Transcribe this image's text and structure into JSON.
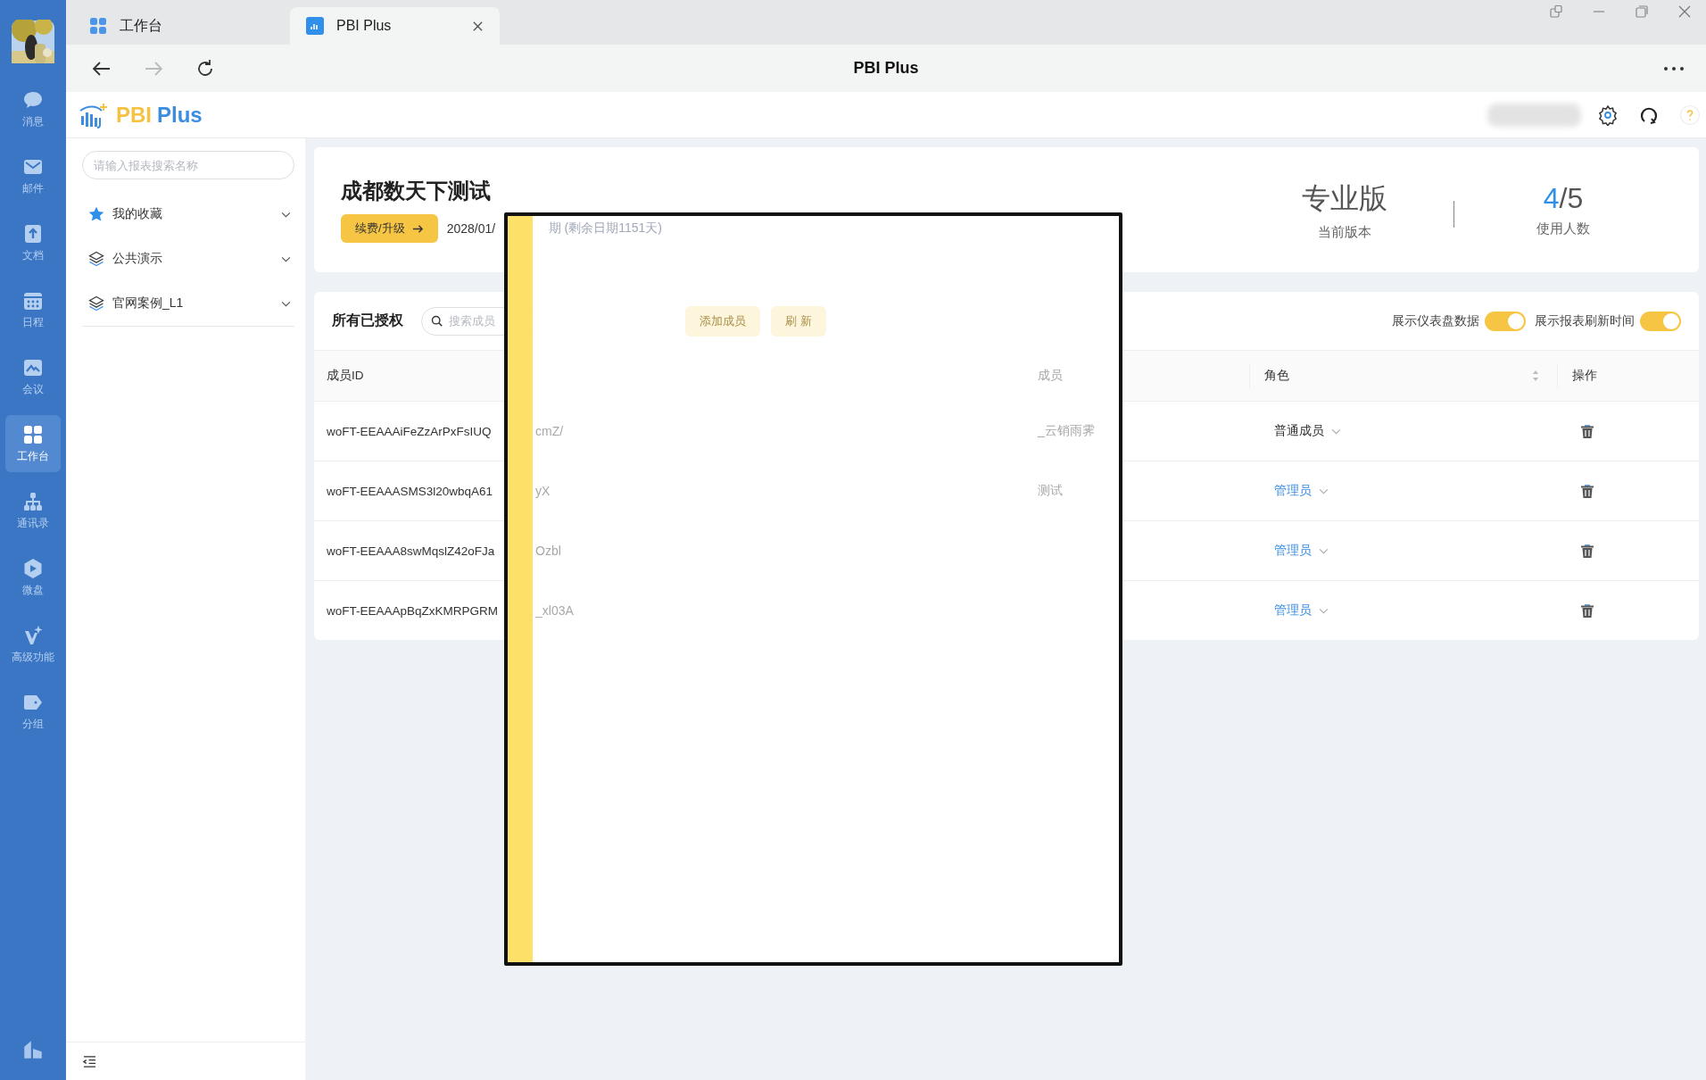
{
  "rail": {
    "items": [
      {
        "label": "消息",
        "selected": false
      },
      {
        "label": "邮件",
        "selected": false
      },
      {
        "label": "文档",
        "selected": false
      },
      {
        "label": "日程",
        "selected": false
      },
      {
        "label": "会议",
        "selected": false
      },
      {
        "label": "工作台",
        "selected": true
      },
      {
        "label": "通讯录",
        "selected": false
      },
      {
        "label": "微盘",
        "selected": false
      },
      {
        "label": "高级功能",
        "selected": false
      },
      {
        "label": "分组",
        "selected": false
      }
    ]
  },
  "tabs": [
    {
      "label": "工作台",
      "selected": false,
      "kind": "workspace"
    },
    {
      "label": "PBI Plus",
      "selected": true,
      "kind": "app"
    }
  ],
  "toolbar": {
    "title": "PBI Plus",
    "back_disabled": false,
    "forward_disabled": true
  },
  "app_header": {
    "logo_a": "PBI",
    "logo_b": "Plus"
  },
  "sidebar": {
    "search": {
      "placeholder": "请输入报表搜索名称"
    },
    "items": [
      {
        "label": "我的收藏",
        "kind": "star"
      },
      {
        "label": "公共演示",
        "kind": "layers"
      },
      {
        "label": "官网案例_L1",
        "kind": "layers"
      }
    ]
  },
  "org": {
    "name": "成都数天下测试",
    "renew_button": "续费/升级",
    "date": "2028/01/",
    "date_rest": "期 (剩余日期1151天)",
    "stats": [
      {
        "value": "专业版",
        "label": "当前版本"
      },
      {
        "value": "4",
        "value_total": "/5",
        "label": "使用人数"
      }
    ]
  },
  "members": {
    "title": "所有已授权",
    "search": {
      "placeholder": "搜索成员"
    },
    "add_button": "添加成员",
    "refresh_button": "刷 新",
    "toggles": [
      {
        "label": "展示仪表盘数据",
        "on": true
      },
      {
        "label": "展示报表刷新时间",
        "on": true
      }
    ],
    "columns": [
      "成员ID",
      "成员",
      "角色",
      "操作"
    ],
    "rows": [
      {
        "id": "woFT-EEAAAiFeZzArPxFsIUQ",
        "id_rest": "cmZ/",
        "member": "_云销雨霁",
        "role": "普通成员",
        "kind": "member"
      },
      {
        "id": "woFT-EEAAASMS3l20wbqA61",
        "id_rest": "yX",
        "member": "测试",
        "role": "管理员",
        "kind": "admin"
      },
      {
        "id": "woFT-EEAAA8swMqslZ42oFJa",
        "id_rest": "Ozbl",
        "role": "管理员",
        "kind": "admin"
      },
      {
        "id": "woFT-EEAAApBqZxKMRPGRM",
        "id_rest": "_xl03A",
        "role": "管理员",
        "kind": "admin"
      }
    ]
  }
}
